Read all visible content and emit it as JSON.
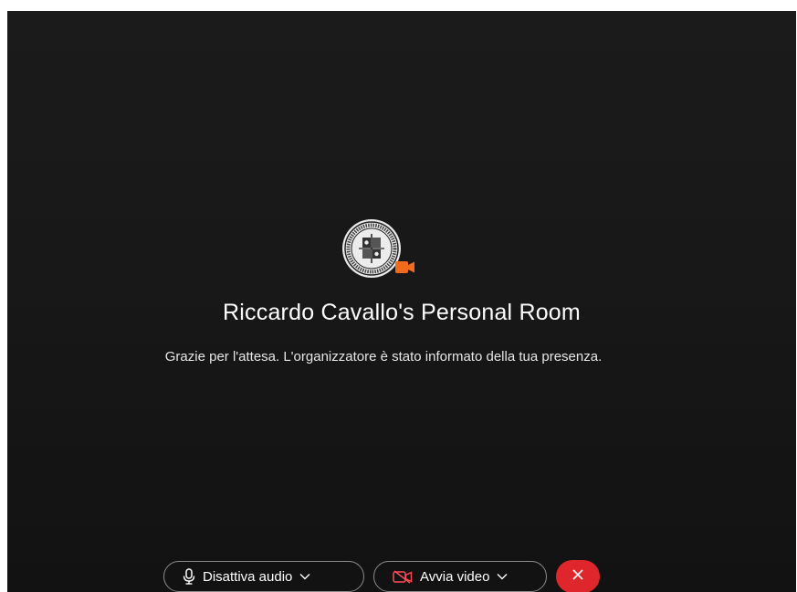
{
  "meeting": {
    "room_title": "Riccardo Cavallo's Personal Room",
    "waiting_message": "Grazie per l'attesa. L'organizzatore è stato informato della tua presenza.",
    "avatar_icon": "university-seal-logo",
    "badge_icon": "video-camera-icon"
  },
  "controls": {
    "audio_label": "Disattiva audio",
    "audio_icon": "microphone-icon",
    "video_label": "Avvia video",
    "video_icon": "video-off-icon",
    "leave_icon": "close-icon"
  },
  "colors": {
    "background": "#181818",
    "accent_badge": "#f26b1d",
    "leave_button": "#e0262d"
  }
}
